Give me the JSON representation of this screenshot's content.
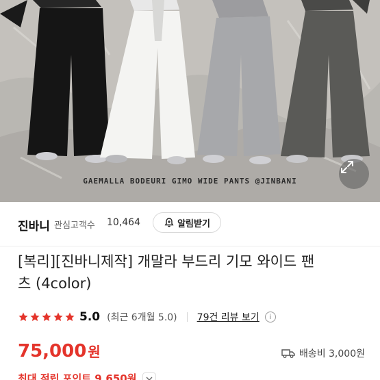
{
  "hero": {
    "image_caption": "GAEMALLA BODEURI GIMO WIDE PANTS @JINBANI",
    "expand_icon": "expand-arrows-icon"
  },
  "seller": {
    "name": "진바니",
    "follower_label": "관심고객수",
    "follower_count": "10,464",
    "alarm_button": "알림받기",
    "alarm_icon": "bell-plus-icon"
  },
  "product": {
    "title_line1": "[복리][진바니제작] 개말라 부드리 기모 와이드 팬",
    "title_line2": "츠 (4color)"
  },
  "rating": {
    "stars": 5,
    "score": "5.0",
    "recent": "(최근 6개월 5.0)",
    "review_link": "79건 리뷰 보기",
    "info_icon": "info-icon",
    "star_color": "#e4342b"
  },
  "price": {
    "amount": "75,000",
    "unit": "원",
    "color": "#e4342b"
  },
  "shipping": {
    "icon": "truck-icon",
    "label": "배송비 3,000원"
  },
  "points": {
    "label": "최대 적립 포인트 9,650원"
  }
}
